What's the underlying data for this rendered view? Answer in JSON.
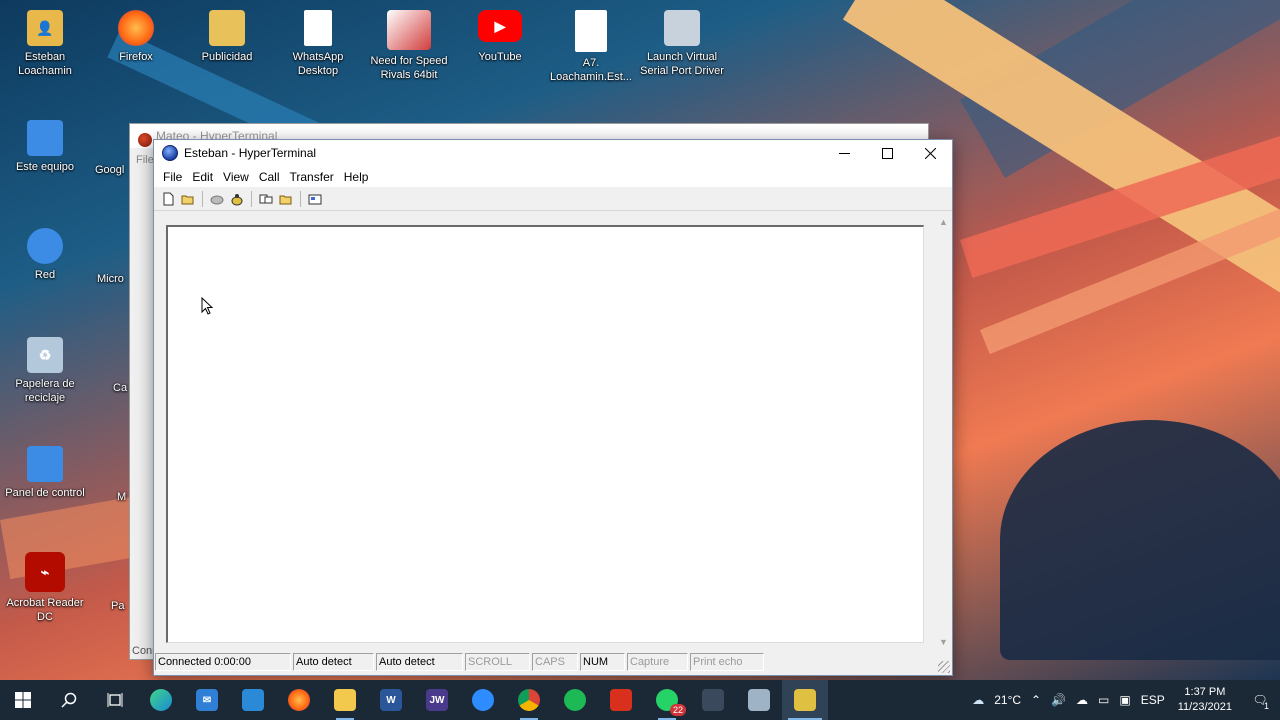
{
  "desktop": {
    "icons": [
      {
        "label": "Esteban Loachamin",
        "glyph": "folder-user-icon",
        "color": "#e8b94a"
      },
      {
        "label": "Firefox",
        "glyph": "firefox-icon",
        "color": "#ff6611"
      },
      {
        "label": "Publicidad",
        "glyph": "folder-icon",
        "color": "#e8c15a"
      },
      {
        "label": "WhatsApp Desktop",
        "glyph": "document-icon",
        "color": "#ffffff"
      },
      {
        "label": "Need for Speed Rivals 64bit",
        "glyph": "game-icon",
        "color": "#d23c3c"
      },
      {
        "label": "YouTube",
        "glyph": "youtube-icon",
        "color": "#ff0000"
      },
      {
        "label": "A7. Loachamin.Est...",
        "glyph": "pdf-document-icon",
        "color": "#ffffff"
      },
      {
        "label": "Launch Virtual Serial Port Driver",
        "glyph": "serial-port-icon",
        "color": "#c8d2dc"
      },
      {
        "label": "Este equipo",
        "glyph": "computer-icon",
        "color": "#3c8ce6"
      },
      {
        "label": "Red",
        "glyph": "network-icon",
        "color": "#3c8ce6"
      },
      {
        "label": "Papelera de reciclaje",
        "glyph": "recycle-bin-icon",
        "color": "#b4c8dc"
      },
      {
        "label": "Panel de control",
        "glyph": "control-panel-icon",
        "color": "#3c8ce6"
      },
      {
        "label": "Acrobat Reader DC",
        "glyph": "acrobat-icon",
        "color": "#b30b00"
      }
    ],
    "partial_labels": {
      "google": "Googl",
      "micro": "Micro",
      "ca": "Ca",
      "m": "M",
      "pa": "Pa"
    }
  },
  "back_window": {
    "title": "Mateo - HyperTerminal",
    "menu_hint": "File",
    "status_hint": "Conn"
  },
  "window": {
    "title": "Esteban - HyperTerminal",
    "menu": [
      "File",
      "Edit",
      "View",
      "Call",
      "Transfer",
      "Help"
    ],
    "toolbar": [
      "new-icon",
      "open-icon",
      "disconnect-icon",
      "dial-icon",
      "send-icon",
      "receive-icon",
      "properties-icon"
    ],
    "status": [
      {
        "text": "Connected 0:00:00",
        "dim": false
      },
      {
        "text": "Auto detect",
        "dim": false
      },
      {
        "text": "Auto detect",
        "dim": false
      },
      {
        "text": "SCROLL",
        "dim": true
      },
      {
        "text": "CAPS",
        "dim": true
      },
      {
        "text": "NUM",
        "dim": false
      },
      {
        "text": "Capture",
        "dim": true
      },
      {
        "text": "Print echo",
        "dim": true
      }
    ]
  },
  "taskbar": {
    "apps": [
      {
        "name": "start-button"
      },
      {
        "name": "search-button"
      },
      {
        "name": "task-view-button"
      },
      {
        "name": "edge-icon"
      },
      {
        "name": "mail-icon"
      },
      {
        "name": "vscode-icon"
      },
      {
        "name": "firefox-icon"
      },
      {
        "name": "file-explorer-icon"
      },
      {
        "name": "word-icon",
        "label": "W"
      },
      {
        "name": "jw-icon",
        "label": "JW"
      },
      {
        "name": "zoom-icon"
      },
      {
        "name": "chrome-icon"
      },
      {
        "name": "spotify-icon"
      },
      {
        "name": "acrobat-icon"
      },
      {
        "name": "whatsapp-icon",
        "badge": "22"
      },
      {
        "name": "terminal-icon"
      },
      {
        "name": "printer-icon"
      },
      {
        "name": "hyperterminal-icon"
      }
    ],
    "temperature": "21°C",
    "language": "ESP",
    "time": "1:37 PM",
    "date": "11/23/2021",
    "notifications": "1"
  }
}
